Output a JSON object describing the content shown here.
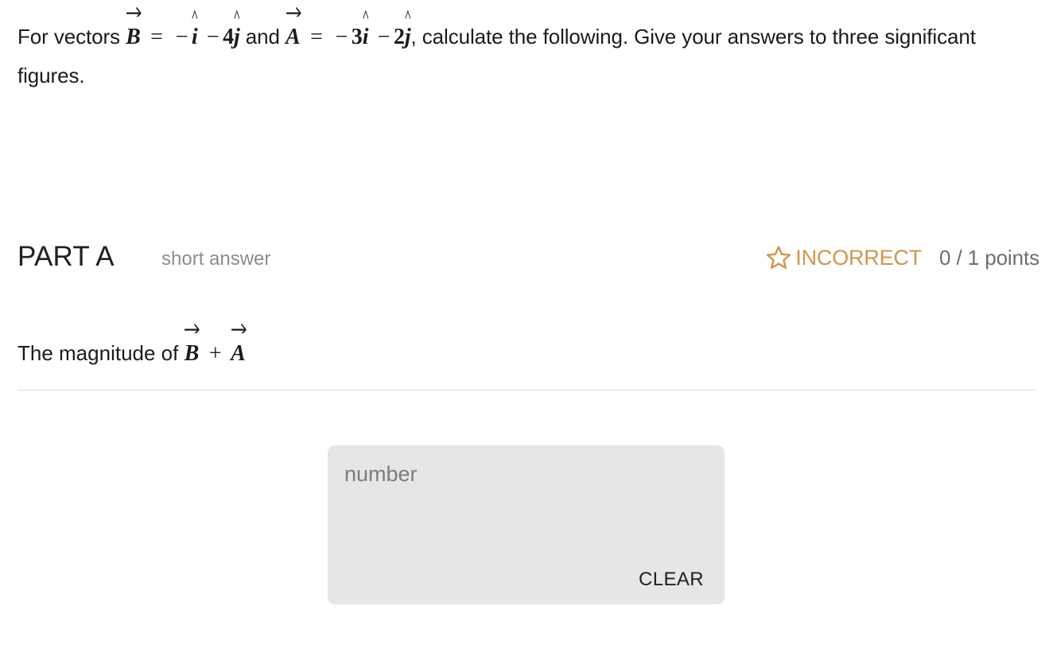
{
  "question": {
    "intro_before_b": "For vectors",
    "vector_b": {
      "symbol": "B",
      "equals": "=",
      "term1_sign": "−",
      "term1_unit": "i",
      "term2_sign": "−",
      "term2_coefficient": "4",
      "term2_unit": "j",
      "latex": "\\vec{B} = -\\hat{i} - 4\\hat{j}"
    },
    "conjunction": "and",
    "vector_a": {
      "symbol": "A",
      "equals": "=",
      "term1_sign": "−",
      "term1_coefficient": "3",
      "term1_unit": "i",
      "term2_sign": "−",
      "term2_coefficient": "2",
      "term2_unit": "j",
      "latex": "\\vec{A} = -3\\hat{i} - 2\\hat{j}"
    },
    "comma": ",",
    "instruction": "calculate the following. Give your answers",
    "instruction_line2": "to three significant figures."
  },
  "part": {
    "label": "PART A",
    "kind": "short answer",
    "status": "INCORRECT",
    "status_icon": "star-outline-icon",
    "points": "0 / 1 points",
    "status_color": "#d4944a",
    "points_color": "#6e6e6e"
  },
  "prompt": {
    "text_before_math": "The magnitude of",
    "math": {
      "left_symbol": "B",
      "operator": "+",
      "right_symbol": "A",
      "latex": "\\vec{B} + \\vec{A}"
    }
  },
  "answer": {
    "placeholder": "number",
    "value": "",
    "clear_label": "CLEAR",
    "background_color": "#e6e6e6"
  }
}
